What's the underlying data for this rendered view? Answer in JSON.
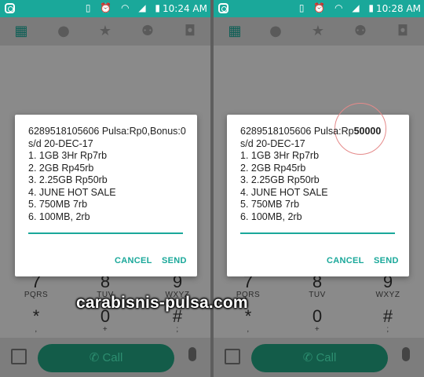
{
  "left": {
    "status_time": "10:24 AM",
    "dialog": {
      "lines": [
        "6289518105606 Pulsa:Rp0,Bonus:0",
        "s/d 20-DEC-17",
        "1. 1GB 3Hr Rp7rb",
        "2. 2GB Rp45rb",
        "3. 2.25GB Rp50rb",
        "4. JUNE HOT SALE",
        "5. 750MB 7rb",
        "6. 100MB, 2rb"
      ],
      "cancel": "CANCEL",
      "send": "SEND"
    }
  },
  "right": {
    "status_time": "10:28 AM",
    "dialog": {
      "line1_prefix": "6289518105606 Pulsa:Rp",
      "line1_bold": "50000",
      "lines": [
        "s/d 20-DEC-17",
        "1. 1GB 3Hr Rp7rb",
        "2. 2GB Rp45rb",
        "3. 2.25GB Rp50rb",
        "4. JUNE HOT SALE",
        "5. 750MB 7rb",
        "6. 100MB, 2rb"
      ],
      "cancel": "CANCEL",
      "send": "SEND"
    }
  },
  "dialpad": {
    "row3": [
      {
        "num": "7",
        "sub": "PQRS"
      },
      {
        "num": "8",
        "sub": "TUV"
      },
      {
        "num": "9",
        "sub": "WXYZ"
      }
    ],
    "row4": [
      {
        "num": "*",
        "sub": ","
      },
      {
        "num": "0",
        "sub": "+"
      },
      {
        "num": "#",
        "sub": ";"
      }
    ]
  },
  "call_label": "Call",
  "watermark": "carabisnis-pulsa.com",
  "colors": {
    "statusbar": "#1aa89a",
    "accent": "#1aa89a",
    "call_button": "#135c49"
  }
}
